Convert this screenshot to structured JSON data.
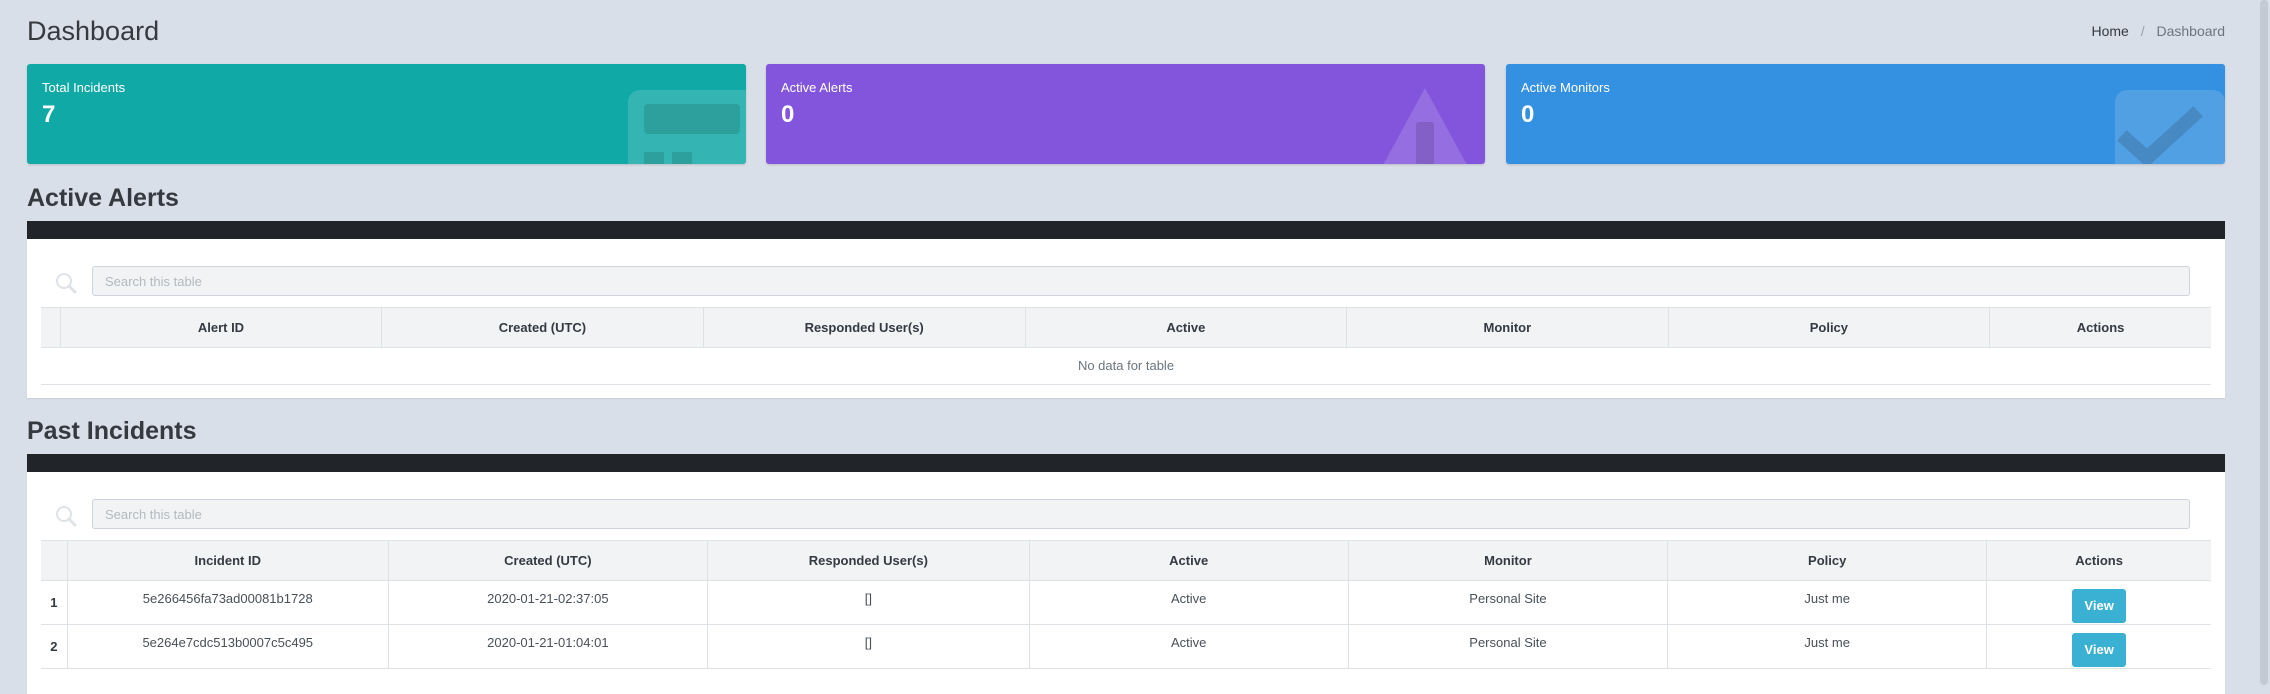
{
  "page": {
    "title": "Dashboard"
  },
  "breadcrumb": {
    "home": "Home",
    "current": "Dashboard"
  },
  "stats": [
    {
      "label": "Total Incidents",
      "value": "7",
      "color": "#11a9a6",
      "icon": "calculator-icon"
    },
    {
      "label": "Active Alerts",
      "value": "0",
      "color": "#8355dc",
      "icon": "warning-icon"
    },
    {
      "label": "Active Monitors",
      "value": "0",
      "color": "#3490e0",
      "icon": "check-square-icon"
    }
  ],
  "active_alerts": {
    "title": "Active Alerts",
    "search_placeholder": "Search this table",
    "columns": [
      "Alert ID",
      "Created (UTC)",
      "Responded User(s)",
      "Active",
      "Monitor",
      "Policy",
      "Actions"
    ],
    "empty_text": "No data for table"
  },
  "past_incidents": {
    "title": "Past Incidents",
    "search_placeholder": "Search this table",
    "columns": [
      "Incident ID",
      "Created (UTC)",
      "Responded User(s)",
      "Active",
      "Monitor",
      "Policy",
      "Actions"
    ],
    "rows": [
      {
        "num": "1",
        "id": "5e266456fa73ad00081b1728",
        "created": "2020-01-21-02:37:05",
        "users": "[]",
        "active": "Active",
        "monitor": "Personal Site",
        "policy": "Just me",
        "action": "View"
      },
      {
        "num": "2",
        "id": "5e264e7cdc513b0007c5c495",
        "created": "2020-01-21-01:04:01",
        "users": "[]",
        "active": "Active",
        "monitor": "Personal Site",
        "policy": "Just me",
        "action": "View"
      }
    ]
  }
}
